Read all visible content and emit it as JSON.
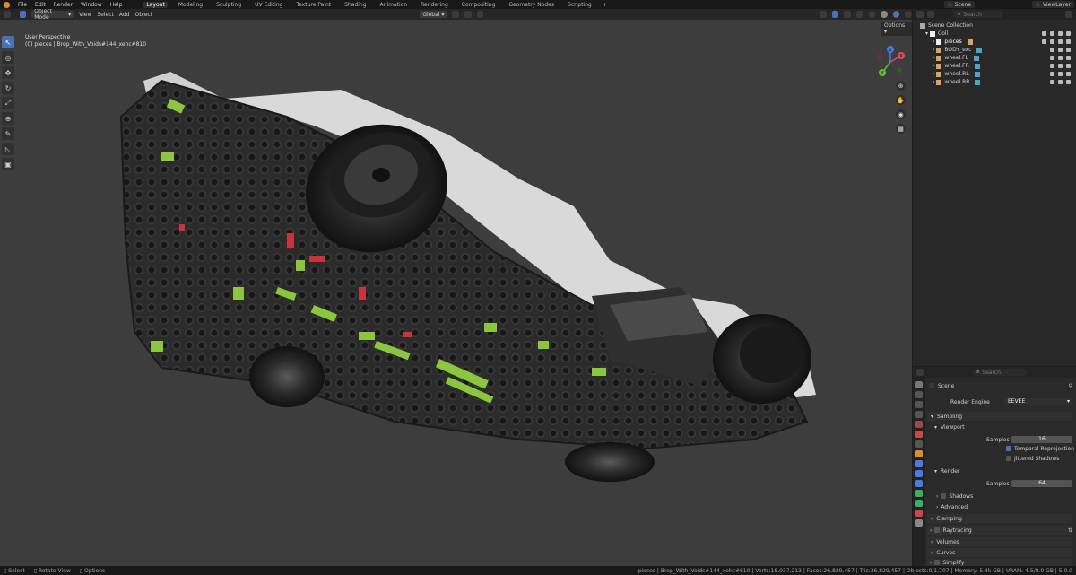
{
  "menu": [
    "File",
    "Edit",
    "Render",
    "Window",
    "Help"
  ],
  "workspaces": [
    {
      "label": "Layout",
      "active": true
    },
    {
      "label": "Modeling"
    },
    {
      "label": "Sculpting"
    },
    {
      "label": "UV Editing"
    },
    {
      "label": "Texture Paint"
    },
    {
      "label": "Shading"
    },
    {
      "label": "Animation"
    },
    {
      "label": "Rendering"
    },
    {
      "label": "Compositing"
    },
    {
      "label": "Geometry Nodes"
    },
    {
      "label": "Scripting"
    }
  ],
  "add_workspace": "+",
  "topright": {
    "scene": "Scene",
    "viewlayer": "ViewLayer"
  },
  "viewport": {
    "mode": "Object Mode",
    "menus": [
      "View",
      "Select",
      "Add",
      "Object"
    ],
    "transform_orientation": "Global",
    "options": "Options",
    "view_label": "User Perspective",
    "object_label": "(0) pieces | Brep_With_Voids#144_xehc#810"
  },
  "gizmo": {
    "x": "X",
    "y": "Y",
    "z": "Z"
  },
  "outliner": {
    "search_placeholder": "Search",
    "rows": [
      {
        "label": "Scene Collection",
        "indent": 0,
        "color": "#cfcfcf"
      },
      {
        "label": "Coll",
        "indent": 1,
        "color": "#ffffff"
      },
      {
        "label": "pieces",
        "indent": 2,
        "color": "#ffffff"
      },
      {
        "label": "BODY_exc",
        "indent": 2,
        "color": "#e0a060"
      },
      {
        "label": "wheel.FL",
        "indent": 2,
        "color": "#e0a060"
      },
      {
        "label": "wheel.FR",
        "indent": 2,
        "color": "#e0a060"
      },
      {
        "label": "wheel.RL",
        "indent": 2,
        "color": "#e0a060"
      },
      {
        "label": "wheel.RR",
        "indent": 2,
        "color": "#e0a060"
      }
    ]
  },
  "properties": {
    "search_placeholder": "Search",
    "context": "Scene",
    "render_engine_label": "Render Engine",
    "render_engine": "EEVEE",
    "sampling": "Sampling",
    "viewport": "Viewport",
    "samples_label": "Samples",
    "viewport_samples": "16",
    "temporal_reprojection": "Temporal Reprojection",
    "jittered_shadows": "Jittered Shadows",
    "render": "Render",
    "render_samples": "64",
    "shadows": "Shadows",
    "advanced": "Advanced",
    "clamping": "Clamping",
    "raytracing": "Raytracing",
    "volumes": "Volumes",
    "curves": "Curves",
    "simplify": "Simplify"
  },
  "status": {
    "select": "Select",
    "rotate": "Rotate View",
    "options": "Options",
    "stats": "pieces | Brep_With_Voids#144_xehc#810 | Verts:18,037,213 | Faces:26,829,457 | Tris:36,829,457 | Objects:0/1,707 | Memory: 5.4k GB | VRAM: 4.5/8.0 GB | 5.0.0"
  },
  "colors": {
    "accent": "#4772b3",
    "viewport_bg": "#3d3d3d",
    "blender_orange": "#e88a2b"
  }
}
